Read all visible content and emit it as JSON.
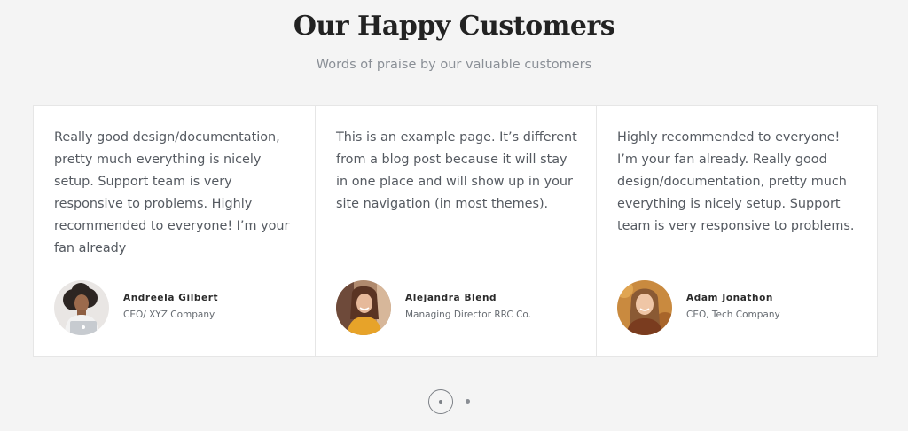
{
  "section": {
    "title": "Our Happy Customers",
    "subtitle": "Words of praise by our valuable customers"
  },
  "testimonials": [
    {
      "quote": "Really good design/documentation, pretty much everything is nicely setup. Support team is very responsive to problems. Highly recommended to everyone! I’m your fan already",
      "name": "Andreela Gilbert",
      "role": "CEO/ XYZ Company",
      "avatar_icon": "woman-with-curly-hair-avatar"
    },
    {
      "quote": "This is an example page. It’s different from a blog post because it will stay in one place and will show up in your site navigation (in most themes).",
      "name": "Alejandra Blend",
      "role": "Managing Director RRC Co.",
      "avatar_icon": "smiling-woman-avatar"
    },
    {
      "quote": "Highly recommended to everyone! I’m your fan already. Really good design/documentation, pretty much everything is nicely setup. Support team is very responsive to problems.",
      "name": "Adam Jonathon",
      "role": "CEO, Tech Company",
      "avatar_icon": "smiling-woman-autumn-avatar"
    }
  ],
  "pagination": {
    "total": 2,
    "active": 1
  },
  "colors": {
    "background": "#f4f4f4",
    "card": "#ffffff",
    "border": "#e6e6e6",
    "heading": "#222222",
    "body_text": "#555a61",
    "muted": "#8a8f96"
  }
}
